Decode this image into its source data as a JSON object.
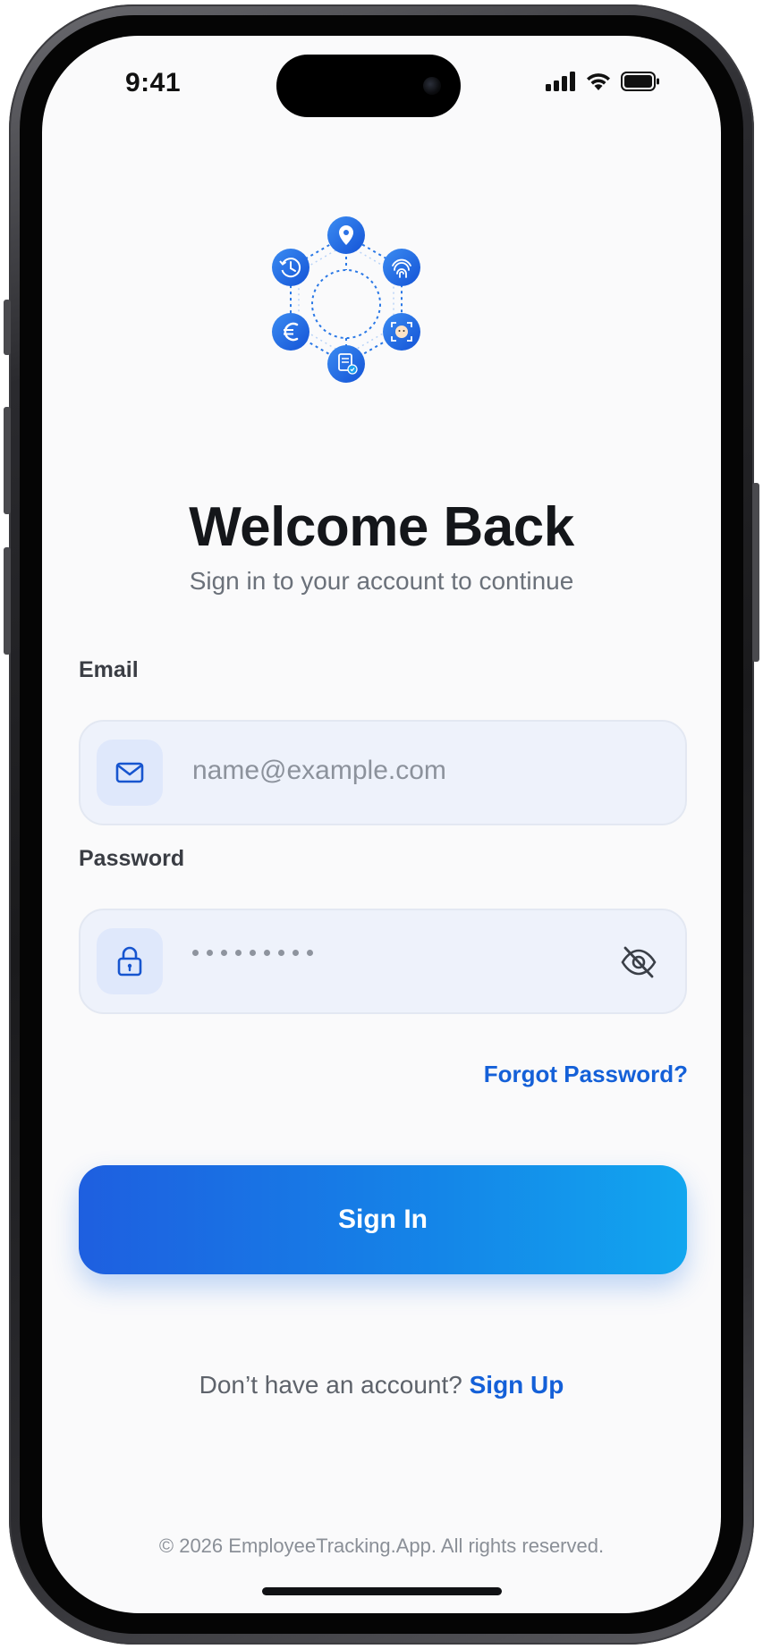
{
  "status_bar": {
    "time": "9:41"
  },
  "login": {
    "title": "Welcome Back",
    "subtitle": "Sign in to your account to continue",
    "email": {
      "label": "Email",
      "placeholder": "name@example.com",
      "icon": "mail-icon"
    },
    "password": {
      "label": "Password",
      "masked_length": 9,
      "icon": "lock-icon",
      "toggle_icon": "eye-off-icon"
    },
    "forgot_password": "Forgot Password?",
    "sign_in_button": "Sign In",
    "signup_prompt": "Don’t have an account?",
    "signup_link": "Sign Up"
  },
  "logo_icons": [
    "location-pin-icon",
    "fingerprint-icon",
    "face-scan-icon",
    "document-check-icon",
    "euro-icon",
    "clock-history-icon"
  ],
  "footer": "© 2026 EmployeeTracking.App. All rights reserved.",
  "colors": {
    "accent": "#1460d8",
    "button_gradient_start": "#1e5fe0",
    "button_gradient_end": "#12a6ef",
    "field_background": "#eef2fb"
  }
}
